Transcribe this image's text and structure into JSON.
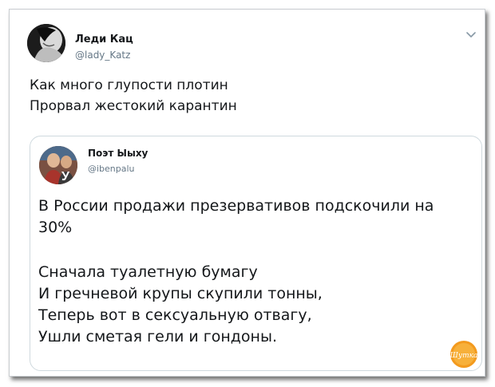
{
  "author": {
    "name": "Леди Кац",
    "handle": "@lady_Katz"
  },
  "tweet": {
    "lines": [
      "Как много глупости плотин",
      "Прорвал жестокий карантин"
    ]
  },
  "quoted": {
    "name": "Поэт Ыыху",
    "handle": "@ibenpalu",
    "lines": [
      "В России продажи презервативов подскочили на",
      "30%",
      "Сначала туалетную бумагу",
      "И гречневой крупы скупили тонны,",
      "Теперь вот в сексуальную отвагу,",
      "Ушли сметая гели и гондоны."
    ],
    "avatar_letter": "У"
  },
  "icons": {
    "menu": "chevron-down-icon",
    "watermark": "site-logo-badge"
  },
  "watermark_text": "Шутка",
  "colors": {
    "text": "#14171a",
    "secondary": "#657786",
    "border": "#cfd9de",
    "watermark": "#f39a1e"
  }
}
